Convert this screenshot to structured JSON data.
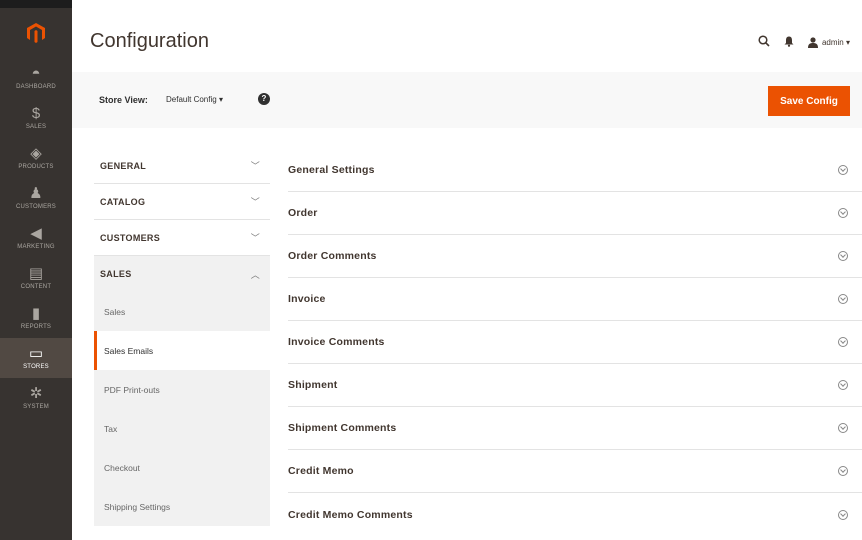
{
  "header": {
    "title": "Configuration",
    "admin_user": "admin ▾"
  },
  "admin_menu": [
    {
      "label": "Dashboard",
      "icon": "dashboard-icon",
      "glyph": "◓"
    },
    {
      "label": "Sales",
      "icon": "dollar-icon",
      "glyph": "$"
    },
    {
      "label": "Products",
      "icon": "cube-icon",
      "glyph": "◈"
    },
    {
      "label": "Customers",
      "icon": "person-icon",
      "glyph": "♟"
    },
    {
      "label": "Marketing",
      "icon": "megaphone-icon",
      "glyph": "◀"
    },
    {
      "label": "Content",
      "icon": "layout-icon",
      "glyph": "▤"
    },
    {
      "label": "Reports",
      "icon": "bar-chart-icon",
      "glyph": "▮"
    },
    {
      "label": "Stores",
      "icon": "store-icon",
      "glyph": "▭"
    },
    {
      "label": "System",
      "icon": "gear-icon",
      "glyph": "✲"
    }
  ],
  "store_view": {
    "label": "Store View:",
    "value": "Default Config",
    "help": "?"
  },
  "save_button": "Save Config",
  "config_tabs": {
    "general": "GENERAL",
    "catalog": "CATALOG",
    "customers": "CUSTOMERS",
    "sales": "SALES",
    "sales_items": [
      "Sales",
      "Sales Emails",
      "PDF Print-outs",
      "Tax",
      "Checkout",
      "Shipping Settings"
    ],
    "active_item": "Sales Emails"
  },
  "sections": [
    "General Settings",
    "Order",
    "Order Comments",
    "Invoice",
    "Invoice Comments",
    "Shipment",
    "Shipment Comments",
    "Credit Memo",
    "Credit Memo Comments"
  ],
  "colors": {
    "accent": "#eb5202",
    "nav_bg": "#373330",
    "nav_active": "#514943"
  }
}
